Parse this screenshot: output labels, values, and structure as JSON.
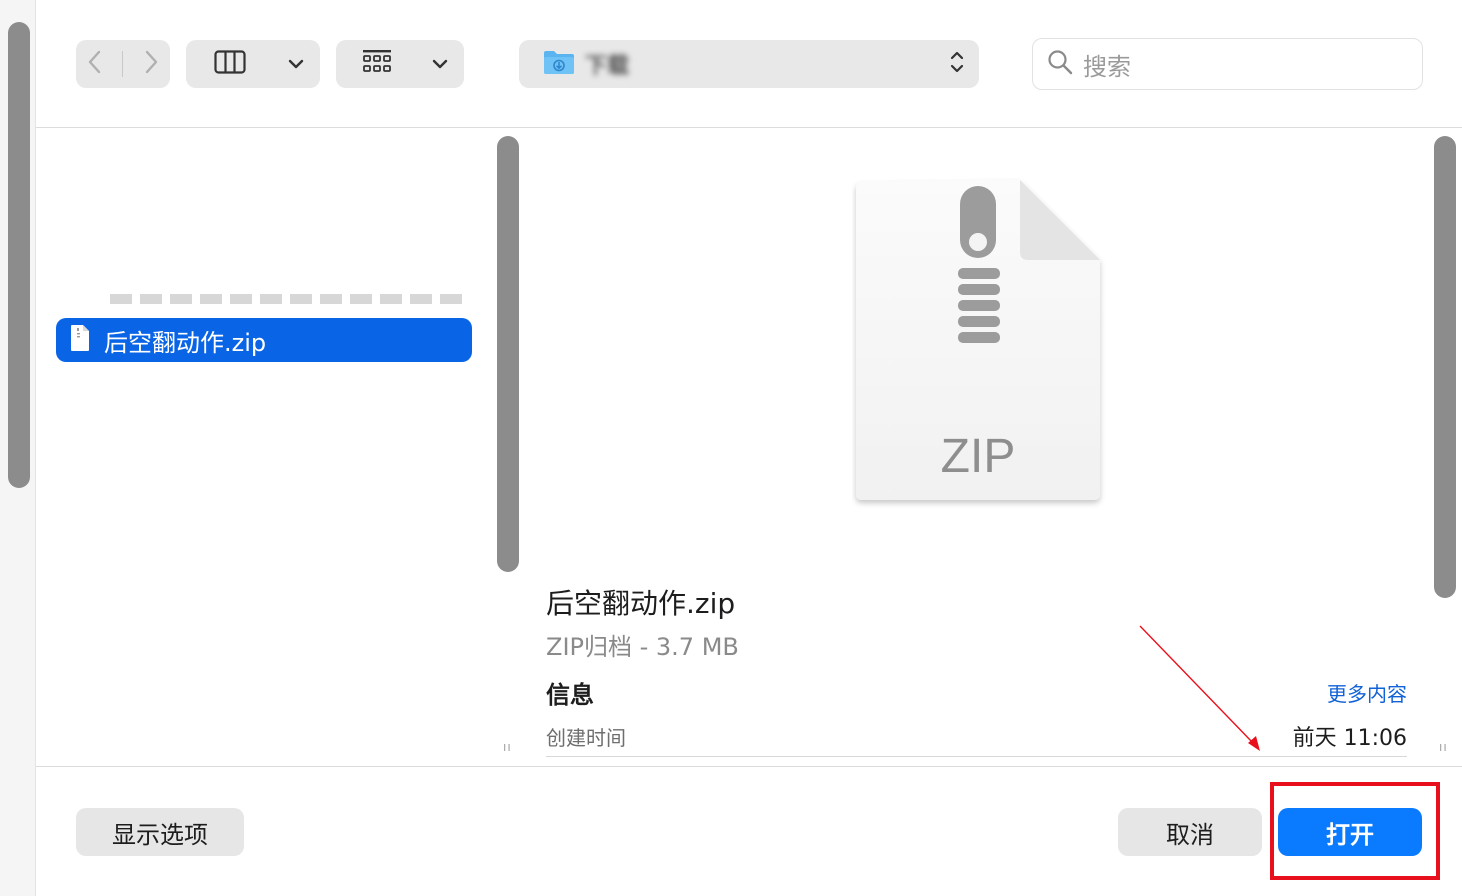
{
  "toolbar": {
    "back_icon": "chevron-left-icon",
    "forward_icon": "chevron-right-icon",
    "view_icon": "columns-view-icon",
    "group_icon": "grid-group-icon",
    "location_name": "下载",
    "location_icon": "downloads-folder-icon",
    "search_placeholder": "搜索"
  },
  "browser": {
    "selected_file": {
      "name": "后空翻动作.zip",
      "icon": "zip-file-icon"
    }
  },
  "preview": {
    "icon_label": "ZIP",
    "file_name": "后空翻动作.zip",
    "file_kind": "ZIP归档 - 3.7 MB",
    "info_heading": "信息",
    "more_link": "更多内容",
    "created_label": "创建时间",
    "created_value": "前天 11:06"
  },
  "footer": {
    "options_label": "显示选项",
    "cancel_label": "取消",
    "open_label": "打开"
  },
  "colors": {
    "accent": "#0a7bff",
    "selection": "#0a64e6",
    "annotation": "#e8101c"
  }
}
